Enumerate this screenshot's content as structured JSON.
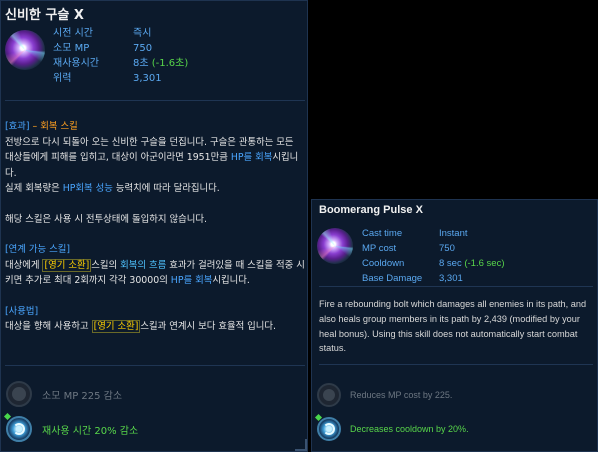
{
  "korean_tooltip": {
    "title": "신비한 구슬 X",
    "stats": [
      {
        "label": "시전 시간",
        "value": "즉시",
        "value_extra": ""
      },
      {
        "label": "소모 MP",
        "value": "750",
        "value_extra": ""
      },
      {
        "label": "재사용시간",
        "value": "8초 ",
        "value_extra": "(-1.6초)"
      },
      {
        "label": "위력",
        "value": "3,301",
        "value_extra": ""
      }
    ],
    "effect_header": "[효과]",
    "effect_dash": " – ",
    "effect_type": "회복 스킬",
    "effect_p1": "전방으로 다시 되돌아 오는 신비한 구슬을 던집니다. 구슬은 관통하는 모든 대상들에게 피해를 입히고, 대상이 아군이라면 1951만큼 ",
    "hp_link": "HP를 회복",
    "effect_p1_end": "시킵니다.",
    "effect_p2_a": "실제 회복량은 ",
    "effect_p2_link": "HP회복 성능",
    "effect_p2_b": " 능력치에 따라 달라집니다.",
    "effect_p3": "해당 스킬은 사용 시 전투상태에 돌입하지 않습니다.",
    "chain_header": "[연계 가능 스킬]",
    "chain_a": "대상에게 ",
    "chain_skill": "[영기 소환]",
    "chain_b": "스킬의 ",
    "chain_flow": "회복의 흐름",
    "chain_c": " 효과가 걸려있을 때 스킬을 적중 시키면 추가로 최대 2회까지 각각 30000의 ",
    "chain_link": "HP를 회복",
    "chain_d": "시킵니다.",
    "usage_header": "[사용법]",
    "usage_a": "대상을 향해 사용하고 ",
    "usage_skill": "[영기 소환]",
    "usage_b": "스킬과 연계시 보다 효율적 입니다.",
    "mod1": "소모 MP 225 감소",
    "mod2": "재사용 시간 20% 감소"
  },
  "english_tooltip": {
    "title": "Boomerang Pulse X",
    "stats": [
      {
        "label": "Cast time",
        "value": "Instant",
        "value_extra": ""
      },
      {
        "label": "MP cost",
        "value": "750",
        "value_extra": ""
      },
      {
        "label": "Cooldown",
        "value": "8 sec ",
        "value_extra": "(-1.6 sec)"
      },
      {
        "label": "Base Damage",
        "value": "3,301",
        "value_extra": ""
      }
    ],
    "description": "Fire a rebounding bolt which damages all enemies in its path, and also heals group members in its path by 2,439 (modified by your heal bonus). Using this skill does not automatically start combat status.",
    "mod1": "Reduces MP cost by 225.",
    "mod2": "Decreases cooldown by 20%."
  }
}
